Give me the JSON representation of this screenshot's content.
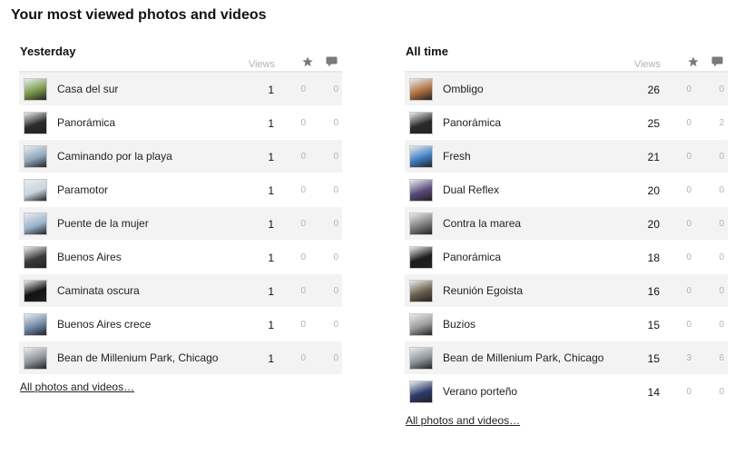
{
  "page": {
    "title": "Your most viewed photos and videos"
  },
  "columns": {
    "views": "Views",
    "favorites_icon": "star-icon",
    "comments_icon": "comment-icon"
  },
  "colors": {
    "row_alt": "#f3f3f3",
    "muted": "#b3b3b3",
    "divider": "#e8e8e8"
  },
  "yesterday": {
    "title": "Yesterday",
    "link": "All photos and videos…",
    "items": [
      {
        "name": "Casa del sur",
        "views": "1",
        "favs": "0",
        "comments": "0",
        "thumb": "#7a9a4a"
      },
      {
        "name": "Panorámica",
        "views": "1",
        "favs": "0",
        "comments": "0",
        "thumb": "#2b2b2b"
      },
      {
        "name": "Caminando por la playa",
        "views": "1",
        "favs": "0",
        "comments": "0",
        "thumb": "#8fa6b8"
      },
      {
        "name": "Paramotor",
        "views": "1",
        "favs": "0",
        "comments": "0",
        "thumb": "#c9d4dd"
      },
      {
        "name": "Puente de la mujer",
        "views": "1",
        "favs": "0",
        "comments": "0",
        "thumb": "#9bb4cf"
      },
      {
        "name": "Buenos Aires",
        "views": "1",
        "favs": "0",
        "comments": "0",
        "thumb": "#3a3a3a"
      },
      {
        "name": "Caminata oscura",
        "views": "1",
        "favs": "0",
        "comments": "0",
        "thumb": "#111111"
      },
      {
        "name": "Buenos Aires crece",
        "views": "1",
        "favs": "0",
        "comments": "0",
        "thumb": "#6f89a6"
      },
      {
        "name": "Bean de Millenium Park, Chicago",
        "views": "1",
        "favs": "0",
        "comments": "0",
        "thumb": "#8d939a"
      }
    ]
  },
  "all_time": {
    "title": "All time",
    "link": "All photos and videos…",
    "items": [
      {
        "name": "Ombligo",
        "views": "26",
        "favs": "0",
        "comments": "0",
        "thumb": "#b0713f"
      },
      {
        "name": "Panorámica",
        "views": "25",
        "favs": "0",
        "comments": "2",
        "thumb": "#2b2b2b"
      },
      {
        "name": "Fresh",
        "views": "21",
        "favs": "0",
        "comments": "0",
        "thumb": "#3f7ec2"
      },
      {
        "name": "Dual Reflex",
        "views": "20",
        "favs": "0",
        "comments": "0",
        "thumb": "#5a4a7a"
      },
      {
        "name": "Contra la marea",
        "views": "20",
        "favs": "0",
        "comments": "0",
        "thumb": "#7d7d7d"
      },
      {
        "name": "Panorámica",
        "views": "18",
        "favs": "0",
        "comments": "0",
        "thumb": "#1c1c1c"
      },
      {
        "name": "Reunión Egoista",
        "views": "16",
        "favs": "0",
        "comments": "0",
        "thumb": "#6b5e4c"
      },
      {
        "name": "Buzios",
        "views": "15",
        "favs": "0",
        "comments": "0",
        "thumb": "#9a9a9a"
      },
      {
        "name": "Bean de Millenium Park, Chicago",
        "views": "15",
        "favs": "3",
        "comments": "6",
        "thumb": "#8d939a"
      },
      {
        "name": "Verano porteño",
        "views": "14",
        "favs": "0",
        "comments": "0",
        "thumb": "#2d3b6a"
      }
    ]
  }
}
